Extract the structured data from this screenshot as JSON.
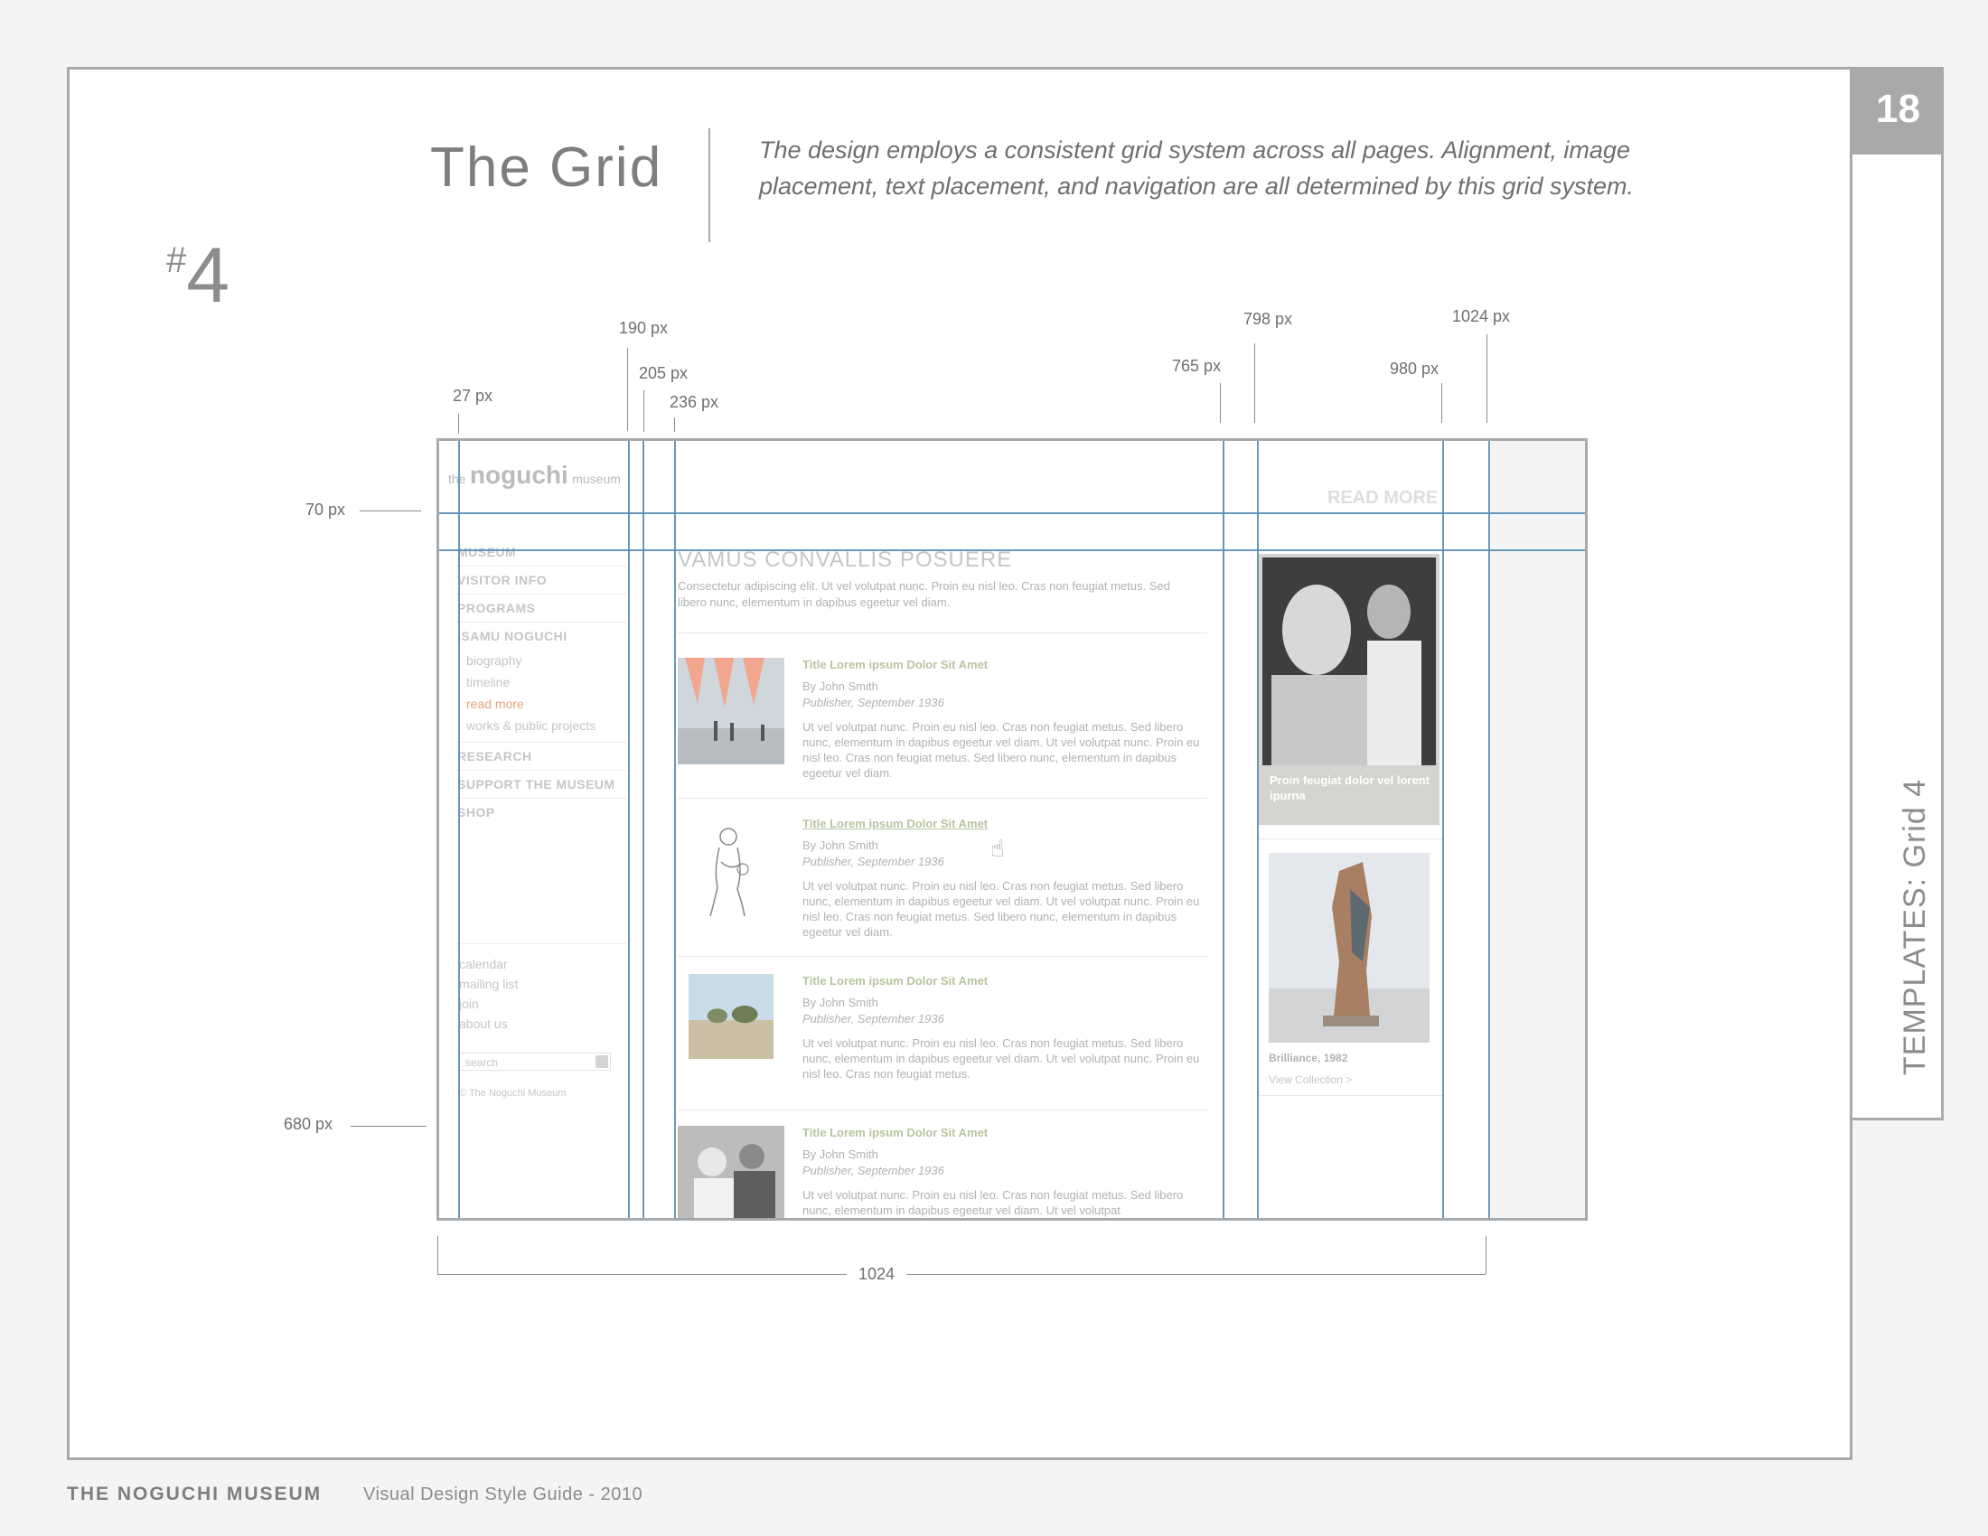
{
  "header": {
    "title": "The Grid",
    "intro": "The design employs a consistent grid system across all pages. Alignment, image placement, text placement, and navigation are all determined by this grid system.",
    "section_hash": "#",
    "section_number": "4"
  },
  "page_tab": {
    "number": "18",
    "label": "TEMPLATES: Grid 4"
  },
  "measurements": {
    "m27": "27 px",
    "m190": "190 px",
    "m205": "205 px",
    "m236": "236 px",
    "m765": "765 px",
    "m798": "798 px",
    "m980": "980 px",
    "m1024": "1024 px",
    "m70": "70 px",
    "m680": "680 px",
    "width_total": "1024"
  },
  "mockup": {
    "logo": {
      "pre": "the",
      "name": "noguchi",
      "post": "museum"
    },
    "read_more": "READ MORE",
    "nav": {
      "museum": "MUSEUM",
      "visitor_info": "VISITOR INFO",
      "programs": "PROGRAMS",
      "isamu_noguchi": "ISAMU NOGUCHI",
      "biography": "biography",
      "timeline": "timeline",
      "read_more": "read more",
      "works": "works & public projects",
      "research": "RESEARCH",
      "support": "SUPPORT THE MUSEUM",
      "shop": "SHOP"
    },
    "util": {
      "calendar": "calendar",
      "mailing": "mailing list",
      "join": "join",
      "about": "about us"
    },
    "search_placeholder": "search",
    "copyright": "© The Noguchi Museum",
    "main_heading": "VAMUS CONVALLIS POSUERE",
    "main_sub": "Consectetur adipiscing elit. Ut vel volutpat nunc. Proin eu nisl leo. Cras non feugiat metus. Sed libero nunc, elementum in dapibus egeetur vel diam.",
    "articles": [
      {
        "title": "Title Lorem ipsum Dolor Sit Amet",
        "by": "By John Smith",
        "pub": "Publisher, September 1936",
        "text": "Ut vel volutpat nunc. Proin eu nisl leo. Cras non feugiat metus. Sed libero nunc, elementum in dapibus egeetur vel diam. Ut vel volutpat nunc. Proin eu nisl leo. Cras non feugiat metus. Sed libero nunc, elementum in dapibus egeetur vel diam."
      },
      {
        "title": "Title Lorem ipsum Dolor Sit Amet",
        "by": "By John Smith",
        "pub": "Publisher, September 1936",
        "text": "Ut vel volutpat nunc. Proin eu nisl leo. Cras non feugiat metus. Sed libero nunc, elementum in dapibus egeetur vel diam. Ut vel volutpat nunc. Proin eu nisl leo. Cras non feugiat metus. Sed libero nunc, elementum in dapibus egeetur vel diam."
      },
      {
        "title": "Title Lorem ipsum Dolor Sit Amet",
        "by": "By John Smith",
        "pub": "Publisher, September 1936",
        "text": "Ut vel volutpat nunc. Proin eu nisl leo. Cras non feugiat metus. Sed libero nunc, elementum in dapibus egeetur vel diam. Ut vel volutpat nunc. Proin eu nisl leo. Cras non feugiat metus."
      },
      {
        "title": "Title Lorem ipsum Dolor Sit Amet",
        "by": "By John Smith",
        "pub": "Publisher, September 1936",
        "text": "Ut vel volutpat nunc. Proin eu nisl leo. Cras non feugiat metus. Sed libero nunc, elementum in dapibus egeetur vel diam. Ut vel volutpat"
      }
    ],
    "feature_caption": "Proin feugiat dolor vel lorent ipurna",
    "sculpture_caption": "Brilliance, 1982",
    "view_collection": "View Collection  >"
  },
  "footer": {
    "brand": "THE NOGUCHI MUSEUM",
    "subtitle": "Visual Design Style Guide - 2010"
  },
  "colors": {
    "grid_line": "#5b8db3",
    "frame": "#a7a9ab",
    "accent_orange": "#e4a27a",
    "accent_green": "#b8c59e"
  }
}
